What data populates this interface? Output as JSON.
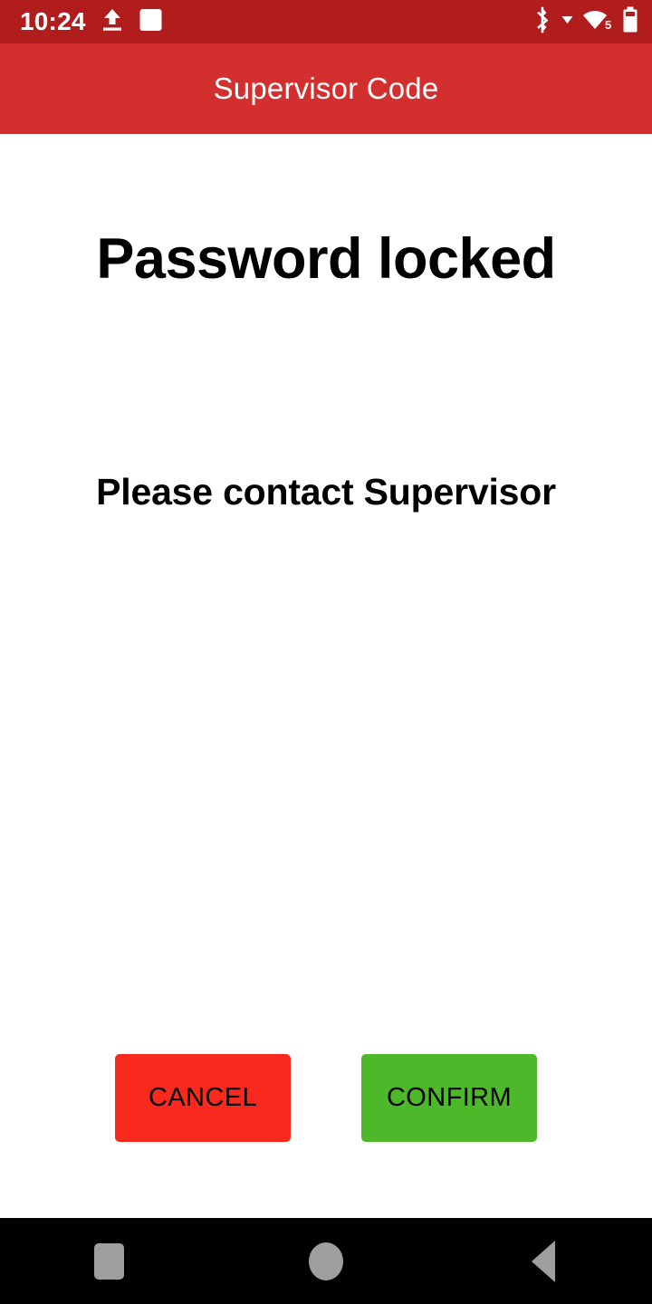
{
  "status_bar": {
    "clock": "10:24",
    "left_icons": [
      {
        "name": "upload-icon"
      },
      {
        "name": "screen-record-icon"
      }
    ],
    "right_icons": [
      {
        "name": "bluetooth-icon"
      },
      {
        "name": "chevron-down-icon"
      },
      {
        "name": "wifi-icon",
        "badge": "5"
      },
      {
        "name": "battery-icon"
      }
    ],
    "background_color": "#b11d1d"
  },
  "app_bar": {
    "title": "Supervisor Code",
    "background_color": "#d32f2f",
    "text_color": "#ffffff"
  },
  "main": {
    "headline": "Password locked",
    "subline": "Please contact Supervisor"
  },
  "buttons": {
    "cancel": {
      "label": "CANCEL",
      "color": "#f82a1e"
    },
    "confirm": {
      "label": "CONFIRM",
      "color": "#4cb82a"
    }
  },
  "nav_bar": {
    "background_color": "#000000",
    "icon_color": "#9e9e9e",
    "items": [
      {
        "name": "recents-button"
      },
      {
        "name": "home-button"
      },
      {
        "name": "back-button"
      }
    ]
  }
}
